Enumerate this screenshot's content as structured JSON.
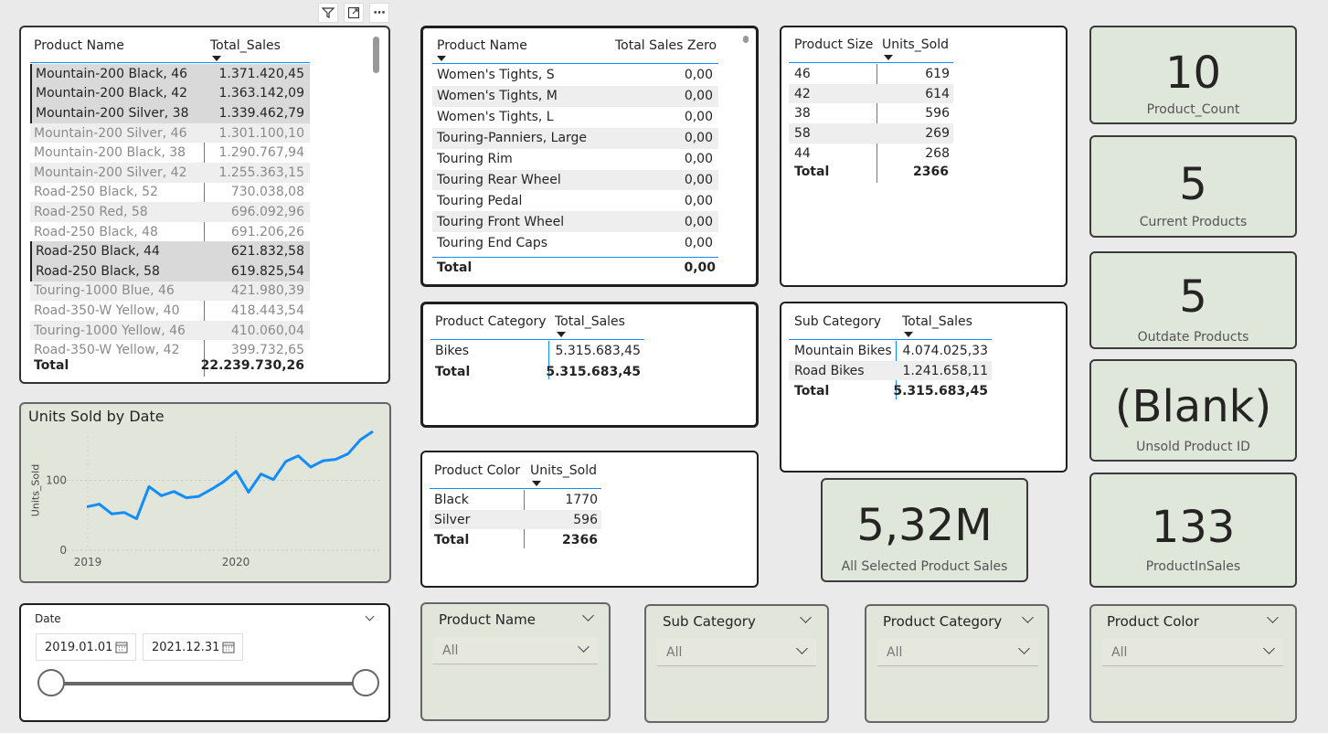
{
  "visual_toolbar": {
    "filter_icon": "funnel-icon",
    "focus_icon": "focus-mode-icon",
    "more_label": "⋯"
  },
  "sales_table": {
    "col1": "Product Name",
    "col2": "Total_Sales",
    "rows": [
      {
        "name": "Mountain-200 Black, 46",
        "value": "1.371.420,45",
        "sel": true
      },
      {
        "name": "Mountain-200 Black, 42",
        "value": "1.363.142,09",
        "sel": true
      },
      {
        "name": "Mountain-200 Silver, 38",
        "value": "1.339.462,79",
        "sel": true
      },
      {
        "name": "Mountain-200 Silver, 46",
        "value": "1.301.100,10",
        "sel": false
      },
      {
        "name": "Mountain-200 Black, 38",
        "value": "1.290.767,94",
        "sel": false
      },
      {
        "name": "Mountain-200 Silver, 42",
        "value": "1.255.363,15",
        "sel": false
      },
      {
        "name": "Road-250 Black, 52",
        "value": "730.038,08",
        "sel": false
      },
      {
        "name": "Road-250 Red, 58",
        "value": "696.092,96",
        "sel": false
      },
      {
        "name": "Road-250 Black, 48",
        "value": "691.206,26",
        "sel": false
      },
      {
        "name": "Road-250 Black, 44",
        "value": "621.832,58",
        "sel": true
      },
      {
        "name": "Road-250 Black, 58",
        "value": "619.825,54",
        "sel": true
      },
      {
        "name": "Touring-1000 Blue, 46",
        "value": "421.980,39",
        "sel": false
      },
      {
        "name": "Road-350-W Yellow, 40",
        "value": "418.443,54",
        "sel": false
      },
      {
        "name": "Touring-1000 Yellow, 46",
        "value": "410.060,04",
        "sel": false
      },
      {
        "name": "Road-350-W Yellow, 42",
        "value": "399.732,65",
        "sel": false
      }
    ],
    "total_label": "Total",
    "total_value": "22.239.730,26"
  },
  "zero_table": {
    "col1": "Product Name",
    "col2": "Total Sales Zero",
    "rows": [
      {
        "name": "Women's Tights, S",
        "value": "0,00"
      },
      {
        "name": "Women's Tights, M",
        "value": "0,00"
      },
      {
        "name": "Women's Tights, L",
        "value": "0,00"
      },
      {
        "name": "Touring-Panniers, Large",
        "value": "0,00"
      },
      {
        "name": "Touring Rim",
        "value": "0,00"
      },
      {
        "name": "Touring Rear Wheel",
        "value": "0,00"
      },
      {
        "name": "Touring Pedal",
        "value": "0,00"
      },
      {
        "name": "Touring Front Wheel",
        "value": "0,00"
      },
      {
        "name": "Touring End Caps",
        "value": "0,00"
      }
    ],
    "total_label": "Total",
    "total_value": "0,00"
  },
  "size_table": {
    "col1": "Product Size",
    "col2": "Units_Sold",
    "rows": [
      {
        "name": "46",
        "value": "619"
      },
      {
        "name": "42",
        "value": "614"
      },
      {
        "name": "38",
        "value": "596"
      },
      {
        "name": "58",
        "value": "269"
      },
      {
        "name": "44",
        "value": "268"
      }
    ],
    "total_label": "Total",
    "total_value": "2366"
  },
  "category_table": {
    "col1": "Product Category",
    "col2": "Total_Sales",
    "rows": [
      {
        "name": "Bikes",
        "value": "5.315.683,45"
      }
    ],
    "total_label": "Total",
    "total_value": "5.315.683,45"
  },
  "subcategory_table": {
    "col1": "Sub Category",
    "col2": "Total_Sales",
    "rows": [
      {
        "name": "Mountain Bikes",
        "value": "4.074.025,33"
      },
      {
        "name": "Road Bikes",
        "value": "1.241.658,11"
      }
    ],
    "total_label": "Total",
    "total_value": "5.315.683,45"
  },
  "color_table": {
    "col1": "Product Color",
    "col2": "Units_Sold",
    "rows": [
      {
        "name": "Black",
        "value": "1770"
      },
      {
        "name": "Silver",
        "value": "596"
      }
    ],
    "total_label": "Total",
    "total_value": "2366"
  },
  "kpis": {
    "product_count": {
      "value": "10",
      "label": "Product_Count"
    },
    "current_products": {
      "value": "5",
      "label": "Current Products"
    },
    "outdate_products": {
      "value": "5",
      "label": "Outdate Products"
    },
    "unsold_product": {
      "value": "(Blank)",
      "label": "Unsold Product ID"
    },
    "product_in_sales": {
      "value": "133",
      "label": "ProductInSales"
    },
    "all_selected_sales": {
      "value": "5,32M",
      "label": "All Selected Product Sales"
    }
  },
  "chart_data": {
    "type": "line",
    "title": "Units Sold by Date",
    "xlabel": "",
    "ylabel": "Units_Sold",
    "x_ticks": [
      "2019",
      "2020"
    ],
    "y_ticks": [
      "0",
      "100"
    ],
    "ylim": [
      0,
      170
    ],
    "color": "#118dff",
    "series": [
      {
        "name": "Units_Sold",
        "values": [
          62,
          66,
          52,
          54,
          45,
          91,
          78,
          84,
          75,
          77,
          87,
          98,
          113,
          83,
          109,
          101,
          127,
          135,
          119,
          128,
          130,
          138,
          158,
          170
        ]
      }
    ]
  },
  "date_slicer": {
    "label": "Date",
    "start": "2019.01.01",
    "end": "2021.12.31",
    "range_fraction": [
      0,
      1
    ]
  },
  "slicers": [
    {
      "title": "Product Name",
      "value": "All"
    },
    {
      "title": "Sub Category",
      "value": "All"
    },
    {
      "title": "Product Category",
      "value": "All"
    },
    {
      "title": "Product Color",
      "value": "All"
    }
  ]
}
